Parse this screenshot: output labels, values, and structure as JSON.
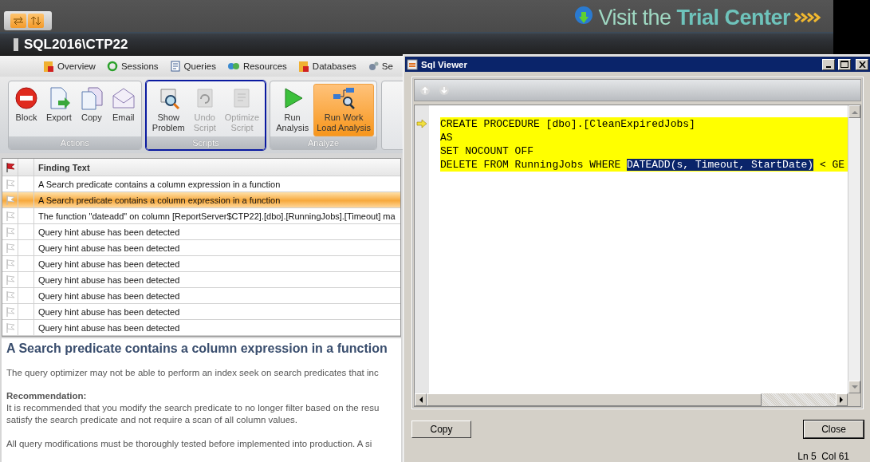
{
  "promo": {
    "text": "Visit the **Trial Center**"
  },
  "server": {
    "title": "SQL2016\\CTP22"
  },
  "nav": [
    {
      "label": "Overview"
    },
    {
      "label": "Sessions"
    },
    {
      "label": "Queries"
    },
    {
      "label": "Resources"
    },
    {
      "label": "Databases"
    },
    {
      "label": "Se"
    }
  ],
  "ribbon": [
    {
      "label": "Actions",
      "focused": false,
      "buttons": [
        {
          "label": "Block",
          "disabled": false,
          "active": false
        },
        {
          "label": "Export",
          "disabled": false,
          "active": false
        },
        {
          "label": "Copy",
          "disabled": false,
          "active": false
        },
        {
          "label": "Email",
          "disabled": false,
          "active": false
        }
      ]
    },
    {
      "label": "Scripts",
      "focused": true,
      "buttons": [
        {
          "label": "Show\nProblem",
          "disabled": false,
          "active": false
        },
        {
          "label": "Undo\nScript",
          "disabled": true,
          "active": false
        },
        {
          "label": "Optimize\nScript",
          "disabled": true,
          "active": false
        }
      ]
    },
    {
      "label": "Analyze",
      "focused": false,
      "buttons": [
        {
          "label": "Run\nAnalysis",
          "disabled": false,
          "active": false
        },
        {
          "label": "Run Work\nLoad Analysis",
          "disabled": false,
          "active": true
        }
      ]
    }
  ],
  "grid": {
    "column_3": "Finding Text",
    "rows": [
      {
        "text": "A Search predicate contains a column expression in a function",
        "selected": false
      },
      {
        "text": "A Search predicate contains a column expression in a function",
        "selected": true
      },
      {
        "text": "The function \"dateadd\" on column [ReportServer$CTP22].[dbo].[RunningJobs].[Timeout] ma",
        "selected": false
      },
      {
        "text": "Query hint abuse has been detected",
        "selected": false
      },
      {
        "text": "Query hint abuse has been detected",
        "selected": false
      },
      {
        "text": "Query hint abuse has been detected",
        "selected": false
      },
      {
        "text": "Query hint abuse has been detected",
        "selected": false
      },
      {
        "text": "Query hint abuse has been detected",
        "selected": false
      },
      {
        "text": "Query hint abuse has been detected",
        "selected": false
      },
      {
        "text": "Query hint abuse has been detected",
        "selected": false
      }
    ]
  },
  "detail": {
    "title": "A Search predicate contains a column expression in a function",
    "description": "The query optimizer may not be able to perform an index seek on search predicates that inc",
    "recommendation_heading": "Recommendation:",
    "recommendation_lines": [
      "It is recommended that you modify the search predicate to no longer filter based on the resu",
      "satisfy the search predicate and not require a scan of all column values."
    ],
    "note": "All query modifications must be thoroughly tested before implemented into production.  A si"
  },
  "sql_viewer": {
    "title": "Sql Viewer",
    "lines": [
      {
        "current": true,
        "highlighted": true,
        "segments": [
          {
            "text": "CREATE PROCEDURE [dbo].[CleanExpiredJobs]",
            "selected": false
          }
        ]
      },
      {
        "current": false,
        "highlighted": true,
        "segments": [
          {
            "text": "AS",
            "selected": false
          }
        ]
      },
      {
        "current": false,
        "highlighted": true,
        "segments": [
          {
            "text": "SET NOCOUNT OFF",
            "selected": false
          }
        ]
      },
      {
        "current": false,
        "highlighted": true,
        "segments": [
          {
            "text": "DELETE FROM RunningJobs WHERE ",
            "selected": false
          },
          {
            "text": "DATEADD(s, Timeout, StartDate)",
            "selected": true
          },
          {
            "text": " < GE",
            "selected": false
          }
        ]
      }
    ],
    "buttons": [
      "Copy",
      "Close"
    ],
    "status": "Ln 5  Col 61"
  }
}
